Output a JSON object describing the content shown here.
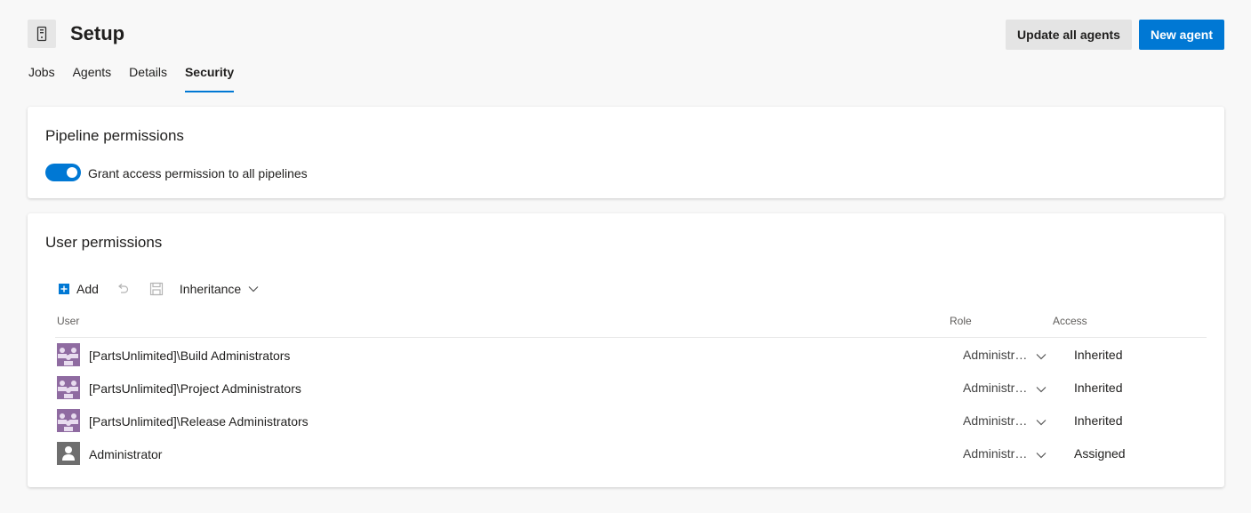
{
  "header": {
    "title": "Setup",
    "icon": "agent-pool-icon",
    "buttons": {
      "update_all_agents": "Update all agents",
      "new_agent": "New agent"
    }
  },
  "tabs": [
    {
      "label": "Jobs",
      "selected": false
    },
    {
      "label": "Agents",
      "selected": false
    },
    {
      "label": "Details",
      "selected": false
    },
    {
      "label": "Security",
      "selected": true
    }
  ],
  "pipeline_permissions": {
    "title": "Pipeline permissions",
    "toggle_label": "Grant access permission to all pipelines",
    "toggle_on": true
  },
  "user_permissions": {
    "title": "User permissions",
    "toolbar": {
      "add_label": "Add",
      "inheritance_label": "Inheritance",
      "icons": [
        "add-icon",
        "undo-icon",
        "save-icon",
        "chevron-down-icon"
      ]
    },
    "columns": {
      "user": "User",
      "role": "Role",
      "access": "Access"
    },
    "rows": [
      {
        "user": "[PartsUnlimited]\\Build Administrators",
        "role": "Administrator",
        "access": "Inherited",
        "avatar": "group-icon"
      },
      {
        "user": "[PartsUnlimited]\\Project Administrators",
        "role": "Administrator",
        "access": "Inherited",
        "avatar": "group-icon"
      },
      {
        "user": "[PartsUnlimited]\\Release Administrators",
        "role": "Administrator",
        "access": "Inherited",
        "avatar": "group-icon"
      },
      {
        "user": "Administrator",
        "role": "Administrator",
        "access": "Assigned",
        "avatar": "user-icon"
      }
    ]
  },
  "colors": {
    "accent": "#0078d4",
    "group_avatar": "#8f6ba1",
    "user_avatar": "#6e6e6e",
    "page_background": "#f8f8f8"
  }
}
